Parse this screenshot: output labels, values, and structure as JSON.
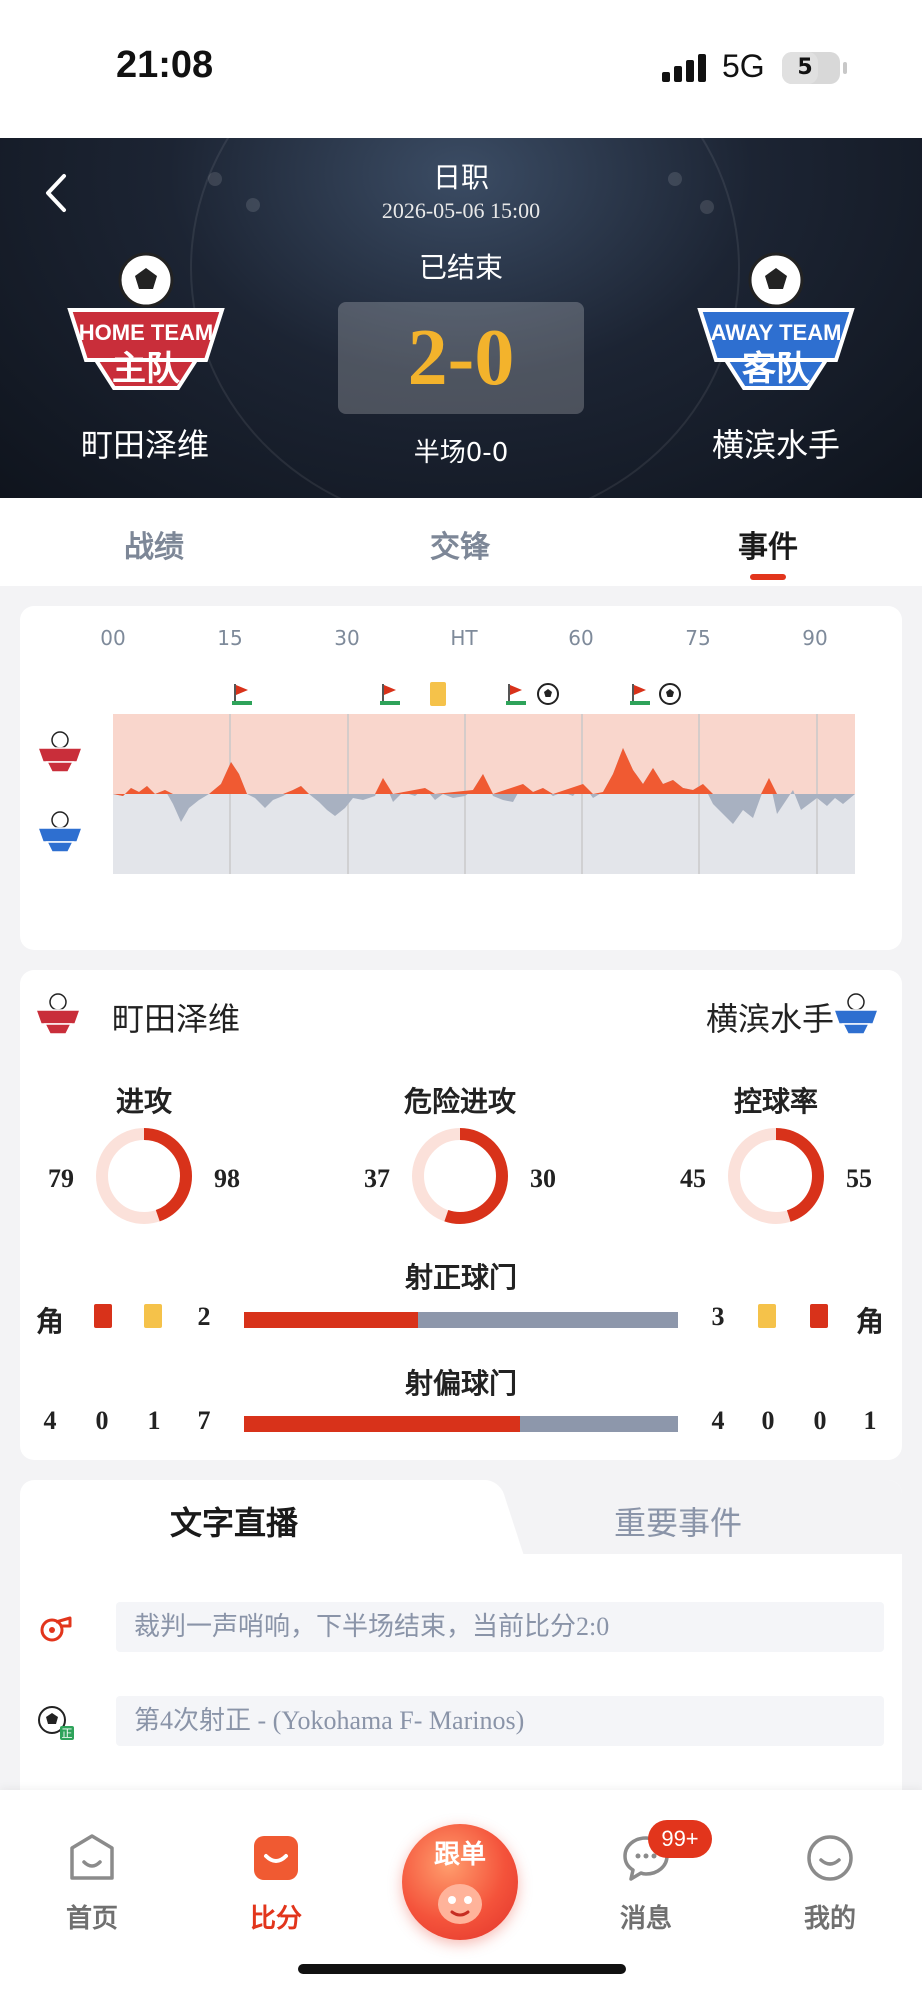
{
  "status_bar": {
    "time": "21:08",
    "network": "5G",
    "battery": "5"
  },
  "match": {
    "league": "日职",
    "datetime": "2026-05-06 15:00",
    "status": "已结束",
    "score": "2-0",
    "halftime": "半场0-0",
    "home_team": "町田泽维",
    "away_team": "横滨水手",
    "home_logo_text": "HOME TEAM 主队",
    "away_logo_text": "AWAY TEAM 客队"
  },
  "tabs": [
    "战绩",
    "交锋",
    "事件"
  ],
  "active_tab": "事件",
  "momentum": {
    "ticks": [
      "00",
      "15",
      "30",
      "HT",
      "60",
      "75",
      "90"
    ],
    "colors": {
      "home": "#f05a32",
      "home_bg": "#f9d6cc",
      "away": "#a8b1c1",
      "away_bg": "#e3e5ea"
    }
  },
  "stats": {
    "home_team": "町田泽维",
    "away_team": "横滨水手",
    "circles": [
      {
        "label": "进攻",
        "home": "79",
        "away": "98",
        "home_share": 0.446
      },
      {
        "label": "危险进攻",
        "home": "37",
        "away": "30",
        "home_share": 0.552
      },
      {
        "label": "控球率",
        "home": "45",
        "away": "55",
        "home_share": 0.45
      }
    ],
    "shots_on_target": {
      "label": "射正球门",
      "home": "2",
      "away": "3",
      "home_share": 0.4
    },
    "shots_off_target": {
      "label": "射偏球门",
      "home": "7",
      "away": "4",
      "home_share": 0.636
    },
    "corner_label": "角",
    "home_row2": [
      "4",
      "0",
      "1",
      "7"
    ],
    "away_row2": [
      "4",
      "0",
      "0",
      "1"
    ]
  },
  "live": {
    "tabs": [
      "文字直播",
      "重要事件"
    ],
    "items": [
      {
        "icon": "whistle-icon",
        "text": "裁判一声哨响，下半场结束，当前比分2:0"
      },
      {
        "icon": "shot-on-target-icon",
        "text": "第4次射正 - (Yokohama F- Marinos)"
      }
    ]
  },
  "bottom_nav": {
    "items": [
      "首页",
      "比分",
      "消息",
      "我的"
    ],
    "active": "比分",
    "center": "跟单",
    "badge": "99+"
  },
  "colors": {
    "accent": "#e2351c",
    "score": "#f3b32c"
  }
}
